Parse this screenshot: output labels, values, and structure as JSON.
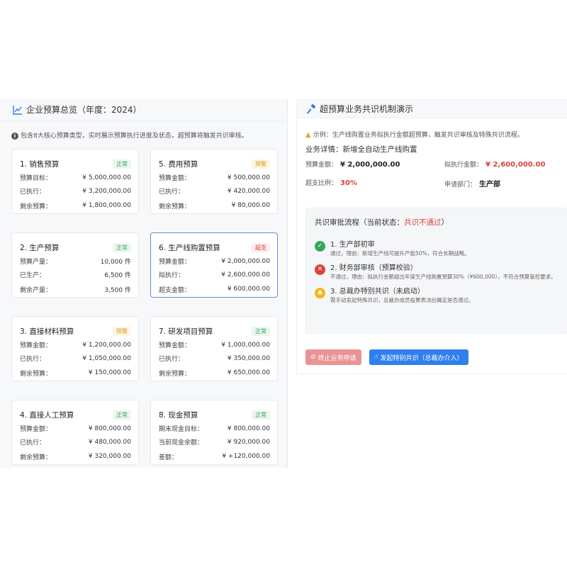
{
  "left": {
    "header": "企业预算总览（年度：2024）",
    "desc": "包含8大核心预算类型，实时展示预算执行进度及状态，超预算将触发共识审核。",
    "cards": [
      {
        "title": "1. 销售预算",
        "badge": "正常",
        "rows": [
          [
            "预算目标：",
            "¥ 5,000,000.00"
          ],
          [
            "已执行：",
            "¥ 3,200,000.00"
          ],
          [
            "剩余预算：",
            "¥ 1,800,000.00"
          ]
        ]
      },
      {
        "title": "5. 费用预算",
        "badge": "预警",
        "rows": [
          [
            "预算金额：",
            "¥ 500,000.00"
          ],
          [
            "已执行：",
            "¥ 420,000.00"
          ],
          [
            "剩余预算：",
            "¥ 80,000.00"
          ]
        ]
      },
      {
        "title": "2. 生产预算",
        "badge": "正常",
        "rows": [
          [
            "预算产量：",
            "10,000 件"
          ],
          [
            "已生产：",
            "6,500 件"
          ],
          [
            "剩余产量：",
            "3,500 件"
          ]
        ]
      },
      {
        "title": "6. 生产线购置预算",
        "badge": "超支",
        "rows": [
          [
            "预算金额：",
            "¥ 2,000,000.00"
          ],
          [
            "拟执行：",
            "¥ 2,600,000.00"
          ],
          [
            "超支金额：",
            "¥ 600,000.00"
          ]
        ]
      },
      {
        "title": "3. 直接材料预算",
        "badge": "预警",
        "rows": [
          [
            "预算金额：",
            "¥ 1,200,000.00"
          ],
          [
            "已执行：",
            "¥ 1,050,000.00"
          ],
          [
            "剩余预算：",
            "¥ 150,000.00"
          ]
        ]
      },
      {
        "title": "7. 研发项目预算",
        "badge": "正常",
        "rows": [
          [
            "预算金额：",
            "¥ 1,000,000.00"
          ],
          [
            "已执行：",
            "¥ 350,000.00"
          ],
          [
            "剩余预算：",
            "¥ 650,000.00"
          ]
        ]
      },
      {
        "title": "4. 直接人工预算",
        "badge": "正常",
        "rows": [
          [
            "预算金额：",
            "¥ 800,000.00"
          ],
          [
            "已执行：",
            "¥ 480,000.00"
          ],
          [
            "剩余预算：",
            "¥ 320,000.00"
          ]
        ]
      },
      {
        "title": "8. 现金预算",
        "badge": "正常",
        "rows": [
          [
            "期末现金目标：",
            "¥ 800,000.00"
          ],
          [
            "当前现金余额：",
            "¥ 920,000.00"
          ],
          [
            "差额：",
            "¥ +120,000.00"
          ]
        ]
      }
    ]
  },
  "right": {
    "header": "超预算业务共识机制演示",
    "warn": "示例：生产线购置业务拟执行金额超预算，触发共识审核及特殊共识流程。",
    "biz_label": "业务详情：",
    "biz_value": "新增全自动生产线购置",
    "budget_label": "预算金额：",
    "budget_value": "¥ 2,000,000.00",
    "plan_label": "拟执行金额：",
    "plan_value": "¥ 2,600,000.00",
    "ratio_label": "超支比例：",
    "ratio_value": "30%",
    "dept_label": "申请部门：",
    "dept_value": "生产部",
    "flow_title": "共识审批流程（当前状态：",
    "flow_status": "共识不通过",
    "flow_close": "）",
    "steps": [
      {
        "title": "1. 生产部初审",
        "sub": "通过，理由：新增生产线可提升产能50%，符合长期战略。"
      },
      {
        "title": "2. 财务部审核（预算校验）",
        "sub": "不通过，理由：拟执行金额超出年度生产线购置预算30%（¥600,000），不符合预算管控要求。"
      },
      {
        "title": "3. 总裁办特别共识（未启动）",
        "sub": "需手动发起特殊共识，总裁办成员投票表决后确定是否通过。"
      }
    ],
    "btn_stop": "终止业务申请",
    "btn_start": "发起特别共识（总裁办介入）"
  },
  "colors": {
    "ok": "#3aa45a",
    "warn": "#d99a1a",
    "over": "#d9443c",
    "primary": "#2f80ed"
  }
}
